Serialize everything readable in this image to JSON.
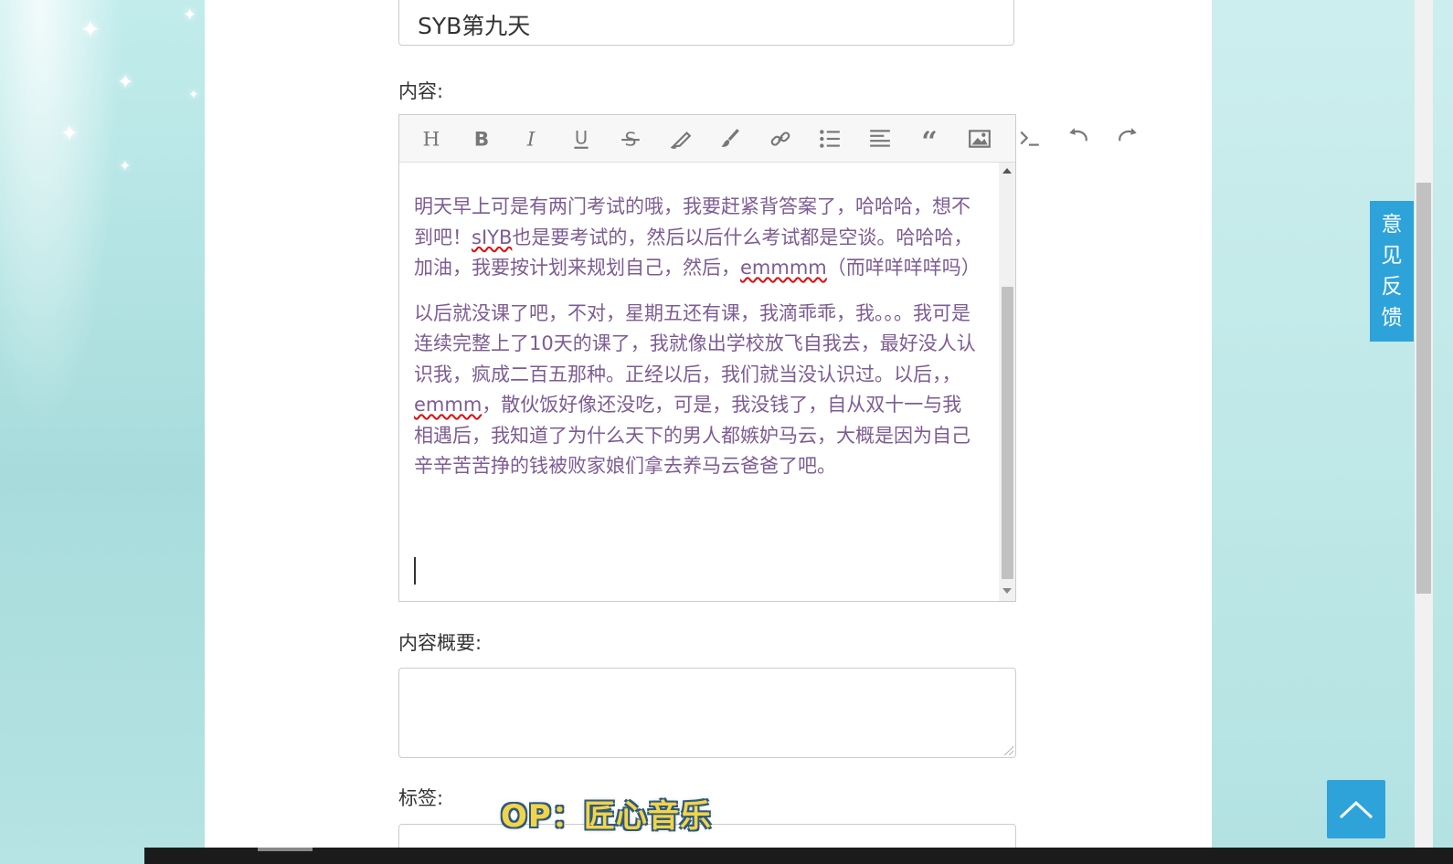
{
  "form": {
    "title_value": "SYB第九天",
    "content_label": "内容:",
    "summary_label": "内容概要:",
    "tags_label": "标签:"
  },
  "editor": {
    "toolbar": [
      {
        "name": "heading-icon",
        "title": "H"
      },
      {
        "name": "bold-icon",
        "title": "B"
      },
      {
        "name": "italic-icon",
        "title": "I"
      },
      {
        "name": "underline-icon",
        "title": "U"
      },
      {
        "name": "strikethrough-icon",
        "title": "S"
      },
      {
        "name": "highlighter-icon",
        "title": ""
      },
      {
        "name": "brush-icon",
        "title": ""
      },
      {
        "name": "link-icon",
        "title": ""
      },
      {
        "name": "bullet-list-icon",
        "title": ""
      },
      {
        "name": "align-icon",
        "title": ""
      },
      {
        "name": "quote-icon",
        "title": ""
      },
      {
        "name": "image-icon",
        "title": ""
      },
      {
        "name": "code-icon",
        "title": ""
      },
      {
        "name": "undo-icon",
        "title": ""
      },
      {
        "name": "redo-icon",
        "title": ""
      }
    ],
    "paragraph1": {
      "part1": "明天早上可是有两门考试的哦，我要赶紧背答案了，哈哈哈，想不到吧！",
      "word1": "sIYB",
      "part2": "也是要考试的，然后以后什么考试都是空谈。哈哈哈，加油，我要按计划来规划自己，然后，",
      "word2": "emmmm",
      "part3": "（而咩咩咩咩吗）"
    },
    "paragraph2": {
      "part1": "以后就没课了吧，不对，星期五还有课，我滴乖乖，我。。。我可是连续完整上了10天的课了，我就像出学校放飞自我去，最好没人认识我，疯成二百五那种。正经以后，我们就当没认识过。以后，，",
      "word1": "emmm",
      "part2": "，散伙饭好像还没吃，可是，我没钱了，自从双十一与我相遇后，我知道了为什么天下的男人都嫉妒马云，大概是因为自己辛辛苦苦挣的钱被败家娘们拿去养马云爸爸了吧。"
    },
    "scroll_position": 0.72
  },
  "watermark": "OP：匠心音乐",
  "feedback": [
    "意",
    "见",
    "反",
    "馈"
  ],
  "colors": {
    "accent": "#2ea3da",
    "text_purple": "#7d5c93"
  }
}
